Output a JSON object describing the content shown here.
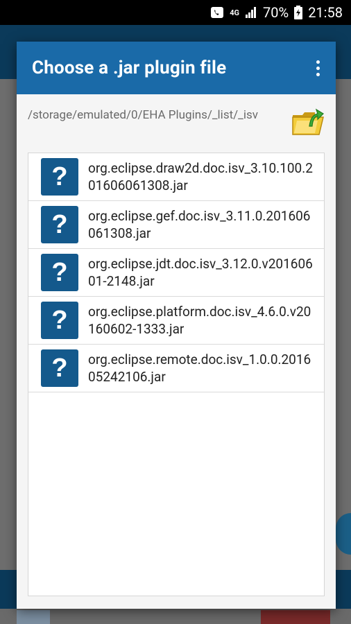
{
  "status_bar": {
    "network": "4G",
    "battery": "70%",
    "time": "21:58"
  },
  "dialog": {
    "title": "Choose a .jar plugin file",
    "path": "/storage/emulated/0/EHA Plugins/_list/_isv",
    "files": [
      {
        "name": "org.eclipse.draw2d.doc.isv_3.10.100.201606061308.jar",
        "icon": "?"
      },
      {
        "name": "org.eclipse.gef.doc.isv_3.11.0.201606061308.jar",
        "icon": "?"
      },
      {
        "name": "org.eclipse.jdt.doc.isv_3.12.0.v20160601-2148.jar",
        "icon": "?"
      },
      {
        "name": "org.eclipse.platform.doc.isv_4.6.0.v20160602-1333.jar",
        "icon": "?"
      },
      {
        "name": "org.eclipse.remote.doc.isv_1.0.0.201605242106.jar",
        "icon": "?"
      }
    ]
  },
  "colors": {
    "header": "#1a6aa8",
    "file_icon": "#14598c"
  }
}
